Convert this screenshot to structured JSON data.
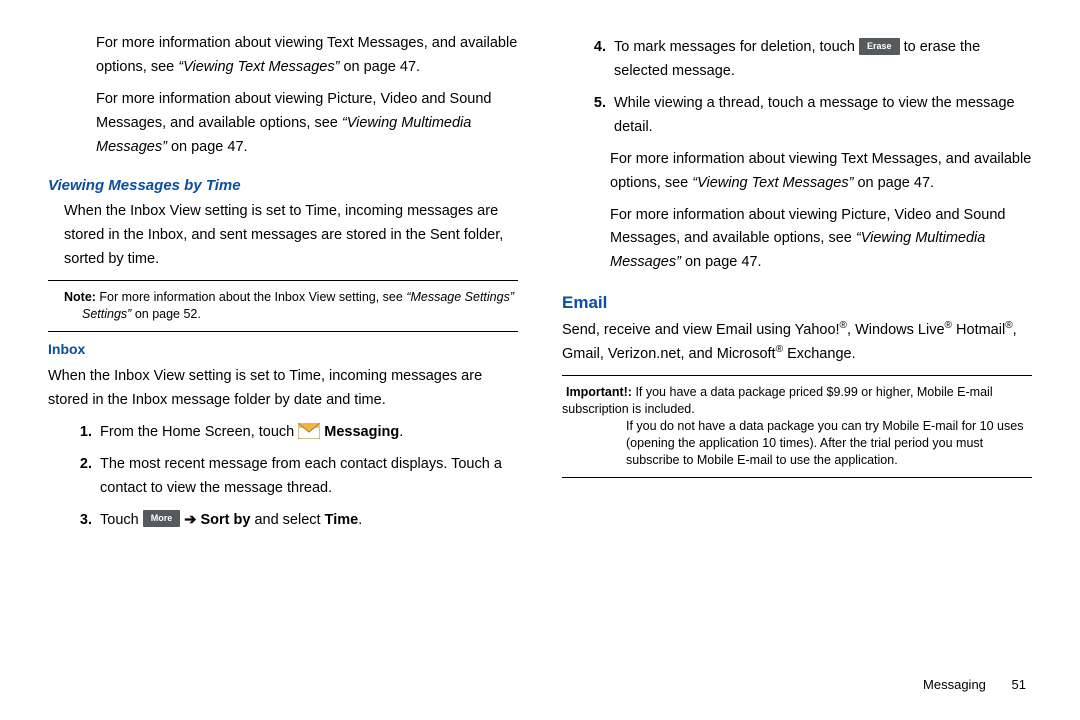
{
  "left": {
    "p1_a": "For more information about viewing Text Messages, and available options, see ",
    "p1_b": "“Viewing Text Messages”",
    "p1_c": " on page 47.",
    "p2_a": "For more information about viewing Picture, Video and Sound Messages, and available options, see ",
    "p2_b": "“Viewing Multimedia Messages”",
    "p2_c": " on page 47.",
    "h1": "Viewing Messages by Time",
    "p3": "When the Inbox View setting is set to Time, incoming messages are stored in the Inbox, and sent messages are stored in the Sent folder, sorted by time.",
    "note_label": "Note:",
    "note_a": " For more information about the Inbox View setting, see ",
    "note_b": "“Message Settings”",
    "note_c": " on page 52.",
    "h2": "Inbox",
    "p4": "When the Inbox View setting is set to Time, incoming messages are stored in the Inbox message folder by date and time.",
    "s1_a": "From the Home Screen, touch ",
    "s1_b": "Messaging",
    "s1_c": ".",
    "s2": "The most recent message from each contact displays. Touch a contact to view the message thread.",
    "s3_a": "Touch ",
    "s3_more": "More",
    "s3_b": " ",
    "s3_arrow": "➔",
    "s3_c": " ",
    "s3_d": "Sort by",
    "s3_e": " and select ",
    "s3_f": "Time",
    "s3_g": "."
  },
  "right": {
    "s4_a": "To mark messages for deletion, touch ",
    "s4_erase": "Erase",
    "s4_b": " to erase the selected message.",
    "s5": "While viewing a thread, touch a message to view the message detail.",
    "p5_a": "For more information about viewing Text Messages, and available options, see ",
    "p5_b": "“Viewing Text Messages”",
    "p5_c": " on page 47.",
    "p6_a": "For more information about viewing Picture, Video and Sound Messages, and available options, see ",
    "p6_b": "“Viewing Multimedia Messages”",
    "p6_c": " on page 47.",
    "h_email": "Email",
    "p7_a": "Send, receive and view Email using Yahoo!",
    "p7_b": ", Windows Live",
    "p7_c": " Hotmail",
    "p7_d": ", Gmail, Verizon.net, and Microsoft",
    "p7_e": " Exchange.",
    "imp_label": "Important!:",
    "imp_a": " If you have a data package priced $9.99 or higher, Mobile E-mail subscription is included.",
    "imp_b": "If you do not have a data package you can try Mobile E-mail for 10 uses (opening the application 10 times). After the trial period you must subscribe to Mobile E-mail to use the application."
  },
  "footer": {
    "section": "Messaging",
    "page": "51"
  },
  "reg": "®"
}
